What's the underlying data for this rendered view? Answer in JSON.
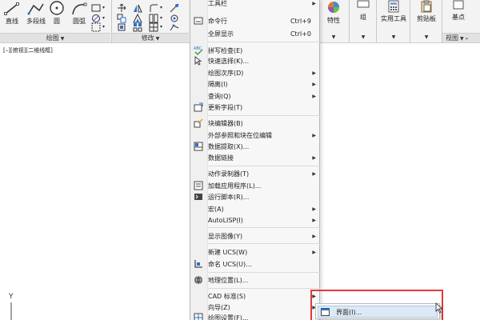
{
  "ribbon": {
    "draw_tools": [
      {
        "label": "直线",
        "icon": "line-icon"
      },
      {
        "label": "多段线",
        "icon": "polyline-icon"
      },
      {
        "label": "圆",
        "icon": "circle-icon"
      },
      {
        "label": "圆弧",
        "icon": "arc-icon"
      }
    ],
    "panels": {
      "draw": "绘图",
      "modify": "修改",
      "view": "视图"
    },
    "right_groups": [
      {
        "label": "特性",
        "icon": "properties-icon"
      },
      {
        "label": "组",
        "icon": "group-icon"
      },
      {
        "label": "实用工具",
        "icon": "utilities-icon"
      },
      {
        "label": "剪贴板",
        "icon": "clipboard-icon"
      },
      {
        "label": "基点",
        "icon": "base-point-icon"
      }
    ]
  },
  "viewport": {
    "label": "[–][俯视][二维线框]",
    "ucs_axis": "Y"
  },
  "menu": {
    "items": [
      {
        "label": "工具栏",
        "shortcut": "",
        "arrow": true,
        "icon": ""
      },
      {
        "label": "命令行",
        "shortcut": "Ctrl+9",
        "arrow": false,
        "icon": "command-line-icon"
      },
      {
        "label": "全屏显示",
        "shortcut": "Ctrl+0",
        "arrow": false,
        "icon": ""
      },
      {
        "label": "拼写检查(E)",
        "shortcut": "",
        "arrow": false,
        "icon": "spell-check-icon"
      },
      {
        "label": "快速选择(K)...",
        "shortcut": "",
        "arrow": false,
        "icon": "quick-select-icon"
      },
      {
        "label": "绘图次序(D)",
        "shortcut": "",
        "arrow": true,
        "icon": ""
      },
      {
        "label": "隔离(I)",
        "shortcut": "",
        "arrow": true,
        "icon": ""
      },
      {
        "label": "查询(Q)",
        "shortcut": "",
        "arrow": true,
        "icon": ""
      },
      {
        "label": "更新字段(T)",
        "shortcut": "",
        "arrow": false,
        "icon": "update-field-icon"
      },
      {
        "label": "块编辑器(B)",
        "shortcut": "",
        "arrow": false,
        "icon": "block-editor-icon"
      },
      {
        "label": "外部参照和块在位编辑",
        "shortcut": "",
        "arrow": true,
        "icon": ""
      },
      {
        "label": "数据提取(X)...",
        "shortcut": "",
        "arrow": false,
        "icon": "data-extraction-icon"
      },
      {
        "label": "数据链接",
        "shortcut": "",
        "arrow": true,
        "icon": ""
      },
      {
        "label": "动作录制器(T)",
        "shortcut": "",
        "arrow": true,
        "icon": ""
      },
      {
        "label": "加载应用程序(L)...",
        "shortcut": "",
        "arrow": false,
        "icon": "load-application-icon"
      },
      {
        "label": "运行脚本(R)...",
        "shortcut": "",
        "arrow": false,
        "icon": "run-script-icon"
      },
      {
        "label": "宏(A)",
        "shortcut": "",
        "arrow": true,
        "icon": ""
      },
      {
        "label": "AutoLISP(I)",
        "shortcut": "",
        "arrow": true,
        "icon": ""
      },
      {
        "label": "显示图像(Y)",
        "shortcut": "",
        "arrow": true,
        "icon": ""
      },
      {
        "label": "新建 UCS(W)",
        "shortcut": "",
        "arrow": true,
        "icon": ""
      },
      {
        "label": "命名 UCS(U)...",
        "shortcut": "",
        "arrow": false,
        "icon": "named-ucs-icon"
      },
      {
        "label": "地理位置(L)...",
        "shortcut": "",
        "arrow": false,
        "icon": "geolocation-icon"
      },
      {
        "label": "CAD 标准(S)",
        "shortcut": "",
        "arrow": true,
        "icon": ""
      },
      {
        "label": "向导(Z)",
        "shortcut": "",
        "arrow": true,
        "icon": ""
      },
      {
        "label": "绘图设置(F)...",
        "shortcut": "",
        "arrow": false,
        "icon": "drafting-settings-icon"
      }
    ]
  },
  "submenu": {
    "label": "界面(I)...",
    "icon": "interface-icon"
  },
  "colors": {
    "highlight_border": "#e23b3b",
    "submenu_hover": "#dde9f6",
    "accent_blue": "#2a6fd0"
  }
}
